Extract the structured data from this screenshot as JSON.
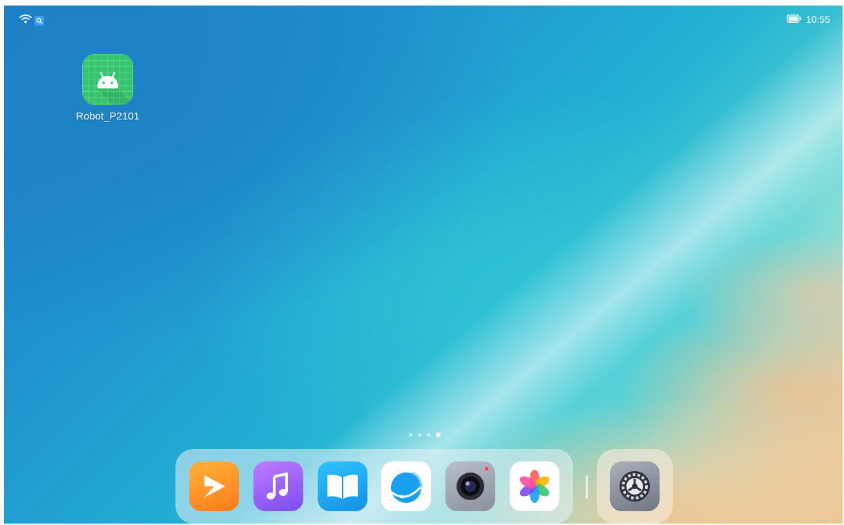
{
  "status_bar": {
    "time": "10:55",
    "icons": [
      "wifi-icon",
      "search-badge-icon",
      "battery-icon"
    ]
  },
  "desktop": {
    "apps": [
      {
        "label": "Robot_P2101",
        "icon": "android-icon",
        "color": "#35c56e"
      }
    ]
  },
  "page_indicator": {
    "pages": 4,
    "current": 4
  },
  "dock": {
    "apps": [
      {
        "name": "video",
        "icon": "video-play-icon"
      },
      {
        "name": "music",
        "icon": "music-note-icon"
      },
      {
        "name": "books",
        "icon": "open-book-icon"
      },
      {
        "name": "browser",
        "icon": "browser-icon"
      },
      {
        "name": "camera",
        "icon": "camera-icon"
      },
      {
        "name": "gallery",
        "icon": "gallery-flower-icon"
      }
    ],
    "fixed_apps": [
      {
        "name": "settings",
        "icon": "gear-icon"
      }
    ]
  }
}
